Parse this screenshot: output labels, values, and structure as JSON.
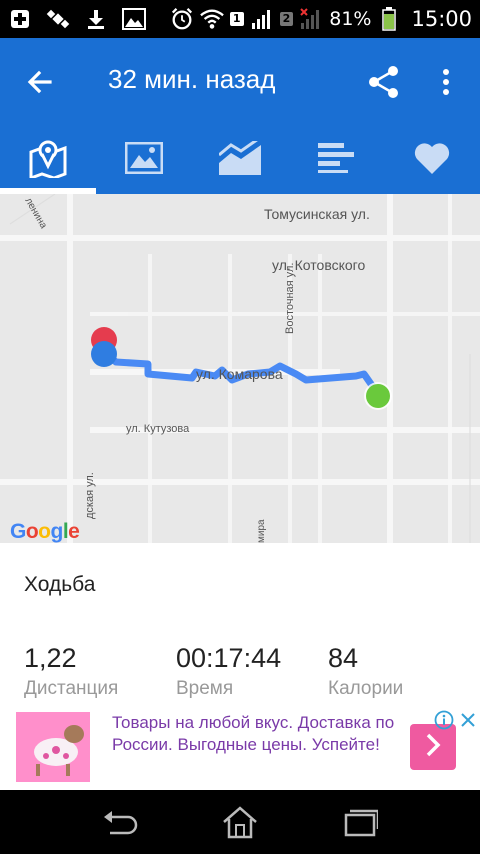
{
  "status_bar": {
    "battery_percent": "81%",
    "time": "15:00",
    "sim1": "1",
    "sim2": "2"
  },
  "app_bar": {
    "title": "32 мин. назад",
    "back_icon": "arrow-left-icon",
    "share_icon": "share-icon",
    "menu_icon": "more-vert-icon"
  },
  "tabs": [
    {
      "icon": "map-icon",
      "active": true
    },
    {
      "icon": "image-icon",
      "active": false
    },
    {
      "icon": "chart-icon",
      "active": false
    },
    {
      "icon": "bars-icon",
      "active": false
    },
    {
      "icon": "heart-icon",
      "active": false
    }
  ],
  "map": {
    "streets": {
      "tomusinskaya": "Томусинская ул.",
      "kotovskogo": "ул. Котовского",
      "komarova": "ул. Комарова",
      "kutuzova": "ул. Кутузова",
      "vostochnaya": "Восточная ул.",
      "lenina": "ленина",
      "skaya": "дская ул.",
      "mira": "мира"
    },
    "google_logo": "Google",
    "colors": {
      "route": "#4a8af4",
      "start": "#6ac93c",
      "end": "#e53c4e",
      "current": "#2f7de1"
    }
  },
  "activity": {
    "name": "Ходьба",
    "stats": [
      {
        "value": "1,22",
        "label": "Дистанция"
      },
      {
        "value": "00:17:44",
        "label": "Время"
      },
      {
        "value": "84",
        "label": "Калории"
      }
    ]
  },
  "ad": {
    "text": "Товары на любой вкус. Доставка по России. Выгодные цены. Успейте!"
  },
  "colors": {
    "primary": "#1a6fd3",
    "ad_text": "#7a3aa8",
    "ad_button": "#ef5aa0"
  }
}
